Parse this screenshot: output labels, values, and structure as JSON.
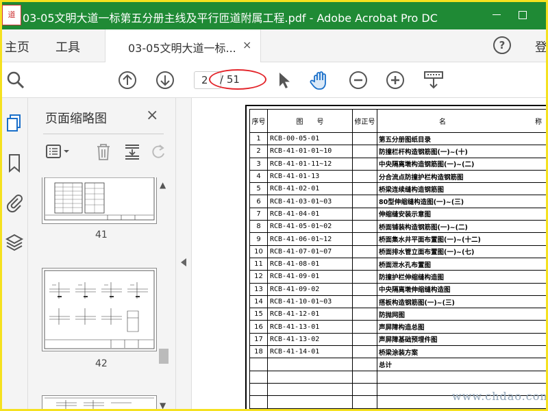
{
  "window": {
    "title": "03-05文明大道一标第五分册主线及平行匝道附属工程.pdf - Adobe Acrobat Pro DC",
    "logo_text": "道"
  },
  "menu": {
    "home": "主页",
    "tools": "工具",
    "login": "登"
  },
  "tab": {
    "label": "03-05文明大道一标...",
    "close": "×"
  },
  "help": {
    "label": "?"
  },
  "toolbar": {
    "page_current": "2",
    "page_total": "/ 51"
  },
  "thumbnails": {
    "title": "页面缩略图",
    "close": "×",
    "pages": [
      {
        "label": "41"
      },
      {
        "label": "42"
      }
    ]
  },
  "table": {
    "headers": [
      "序号",
      "图　　号",
      "修正号",
      "名　　　　　　　　　　　　　称"
    ],
    "rows": [
      {
        "no": "1",
        "code": "RCB-00-05-01",
        "name": "第五分册图纸目录"
      },
      {
        "no": "2",
        "code": "RCB-41-01-01~10",
        "name": "防撞栏杆构造钢筋图(一)~(十)"
      },
      {
        "no": "3",
        "code": "RCB-41-01-11~12",
        "name": "中央隔离墩构造钢筋图(一)~(二)"
      },
      {
        "no": "4",
        "code": "RCB-41-01-13",
        "name": "分合流点防撞护栏构造钢筋图"
      },
      {
        "no": "5",
        "code": "RCB-41-02-01",
        "name": "桥梁连续缝构造钢筋图"
      },
      {
        "no": "6",
        "code": "RCB-41-03-01~03",
        "name": "80型伸缩缝构造图(一)~(三)"
      },
      {
        "no": "7",
        "code": "RCB-41-04-01",
        "name": "伸缩缝安装示意图"
      },
      {
        "no": "8",
        "code": "RCB-41-05-01~02",
        "name": "桥面铺装构造钢筋图(一)~(二)"
      },
      {
        "no": "9",
        "code": "RCB-41-06-01~12",
        "name": "桥面集水井平面布置图(一)~(十二)"
      },
      {
        "no": "10",
        "code": "RCB-41-07-01~07",
        "name": "桥面排水管立面布置图(一)~(七)"
      },
      {
        "no": "11",
        "code": "RCB-41-08-01",
        "name": "桥面泄水孔布置图"
      },
      {
        "no": "12",
        "code": "RCB-41-09-01",
        "name": "防撞护栏伸缩缝构造图"
      },
      {
        "no": "13",
        "code": "RCB-41-09-02",
        "name": "中央隔离墩伸缩缝构造图"
      },
      {
        "no": "14",
        "code": "RCB-41-10-01~03",
        "name": "搭板构造钢筋图(一)~(三)"
      },
      {
        "no": "15",
        "code": "RCB-41-12-01",
        "name": "防抛网图"
      },
      {
        "no": "16",
        "code": "RCB-41-13-01",
        "name": "声屏障构造总图"
      },
      {
        "no": "17",
        "code": "RCB-41-13-02",
        "name": "声屏障基础预埋件图"
      },
      {
        "no": "18",
        "code": "RCB-41-14-01",
        "name": "桥梁涂装方案"
      },
      {
        "no": "",
        "code": "",
        "name": "总计"
      },
      {
        "no": "",
        "code": "",
        "name": ""
      },
      {
        "no": "",
        "code": "",
        "name": ""
      },
      {
        "no": "",
        "code": "",
        "name": ""
      }
    ]
  },
  "watermark": "www.chdao.com"
}
